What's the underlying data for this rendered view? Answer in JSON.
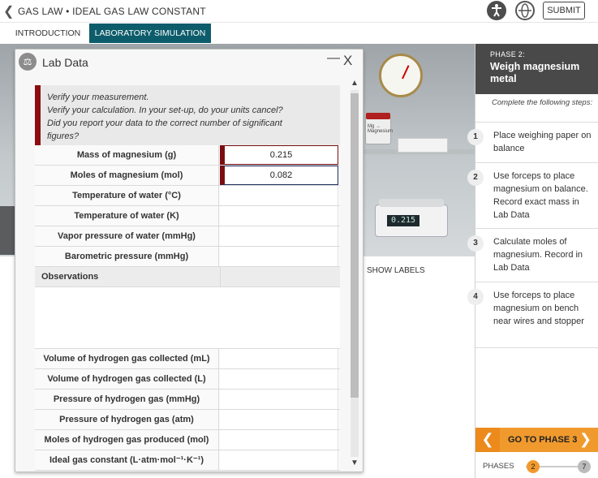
{
  "app_title": "GAS LAW • IDEAL GAS LAW CONSTANT",
  "submit_label": "SUBMIT",
  "tabs": [
    {
      "label": "INTRODUCTION"
    },
    {
      "label": "LABORATORY SIMULATION"
    }
  ],
  "scene": {
    "show_labels": "SHOW LABELS",
    "mg_jar_label": "Mg → Magnesium",
    "balance_readout": "0.215"
  },
  "lab_data": {
    "title": "Lab Data",
    "note_lines": [
      "Verify your measurement.",
      "Verify your calculation. In your set-up, do your units cancel?",
      "Did you report your data to the correct number of significant",
      "figures?"
    ],
    "rows": [
      {
        "label": "Mass of magnesium (g)",
        "value": "0.215"
      },
      {
        "label": "Moles of magnesium (mol)",
        "value": "0.082"
      },
      {
        "label": "Temperature of water (°C)",
        "value": ""
      },
      {
        "label": "Temperature of water (K)",
        "value": ""
      },
      {
        "label": "Vapor pressure of water (mmHg)",
        "value": ""
      },
      {
        "label": "Barometric pressure (mmHg)",
        "value": ""
      }
    ],
    "observations_label": "Observations",
    "rows2": [
      {
        "label": "Volume of hydrogen gas collected (mL)",
        "value": ""
      },
      {
        "label": "Volume of hydrogen gas collected (L)",
        "value": ""
      },
      {
        "label": "Pressure of hydrogen gas (mmHg)",
        "value": ""
      },
      {
        "label": "Pressure of hydrogen gas (atm)",
        "value": ""
      },
      {
        "label": "Moles of hydrogen gas produced (mol)",
        "value": ""
      },
      {
        "label": "Ideal gas constant (L·atm·mol⁻¹·K⁻¹)",
        "value": ""
      }
    ]
  },
  "phase_panel": {
    "phase_label": "PHASE 2:",
    "phase_title": "Weigh magnesium metal",
    "steps_intro": "Complete the following steps:",
    "steps": [
      {
        "num": "1",
        "text": "Place weighing paper on balance"
      },
      {
        "num": "2",
        "text": "Use forceps to place magnesium on balance. Record exact mass in Lab Data"
      },
      {
        "num": "3",
        "text": "Calculate moles of magnesium. Record in Lab Data"
      },
      {
        "num": "4",
        "text": "Use forceps to place magnesium on bench near wires and stopper"
      }
    ],
    "go_label": "GO TO PHASE 3",
    "phases_label": "PHASES",
    "current_phase": "2",
    "total_phases": "7"
  }
}
